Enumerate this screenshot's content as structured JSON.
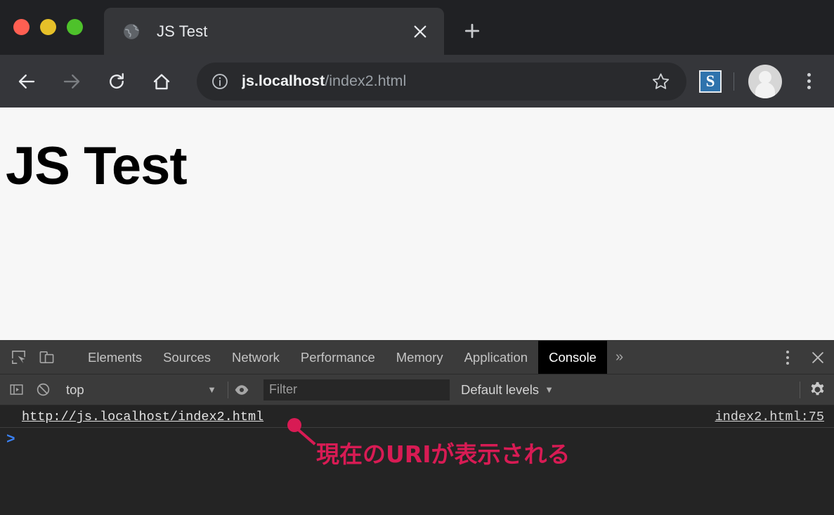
{
  "window": {
    "traffic_lights": [
      {
        "name": "close",
        "color": "#ff5f52"
      },
      {
        "name": "minimize",
        "color": "#e6c029"
      },
      {
        "name": "maximize",
        "color": "#4ec22b"
      }
    ]
  },
  "tabstrip": {
    "tab": {
      "title": "JS Test",
      "favicon": "globe-icon",
      "close_label": "✕"
    },
    "new_tab_label": "+"
  },
  "toolbar": {
    "back_label": "←",
    "forward_label": "→",
    "reload_label": "⟳",
    "home_label": "⌂",
    "info_label": "ⓘ",
    "url_host": "js.localhost",
    "url_path": "/index2.html",
    "url_full": "js.localhost/index2.html",
    "star_label": "☆",
    "extension_label": "S",
    "extension_color": "#2f73ad",
    "avatar_label": "profile-avatar",
    "menu_label": "⋮"
  },
  "page": {
    "heading": "JS Test",
    "background": "#f7f7f7"
  },
  "devtools": {
    "icons": {
      "inspect": "inspect-element-icon",
      "device": "device-toolbar-icon"
    },
    "tabs": [
      {
        "label": "Elements",
        "active": false
      },
      {
        "label": "Sources",
        "active": false
      },
      {
        "label": "Network",
        "active": false
      },
      {
        "label": "Performance",
        "active": false
      },
      {
        "label": "Memory",
        "active": false
      },
      {
        "label": "Application",
        "active": false
      },
      {
        "label": "Console",
        "active": true
      }
    ],
    "more_tabs_label": "»",
    "menu_label": "⋮",
    "close_label": "✕",
    "filterbar": {
      "sidebar_toggle": "console-sidebar-icon",
      "clear_label": "clear-console-icon",
      "context": "top",
      "context_caret": "▼",
      "eye_label": "live-expression-icon",
      "filter_placeholder": "Filter",
      "filter_value": "",
      "levels": "Default levels",
      "levels_caret": "▼",
      "settings_label": "settings-gear-icon"
    },
    "console": {
      "messages": [
        {
          "text": "http://js.localhost/index2.html",
          "source": "index2.html:75"
        }
      ],
      "prompt_caret": ">"
    }
  },
  "annotation": {
    "text": "現在のURIが表示される",
    "color": "#d81b54"
  }
}
